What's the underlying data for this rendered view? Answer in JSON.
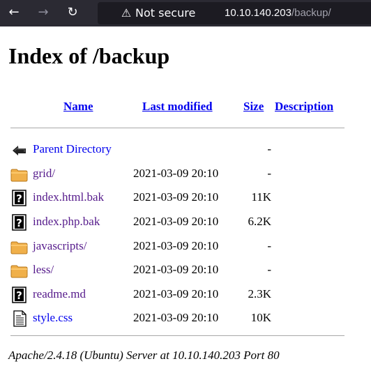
{
  "browser": {
    "back_icon": "arrow-left-icon",
    "forward_icon": "arrow-right-icon",
    "reload_icon": "reload-icon",
    "security_label": "Not secure",
    "url_host": "10.10.140.203",
    "url_path": "/backup/"
  },
  "page": {
    "title": "Index of /backup",
    "columns": {
      "name": "Name",
      "last_modified": "Last modified",
      "size": "Size",
      "description": "Description"
    },
    "rows": [
      {
        "name": "Parent Directory",
        "date": "",
        "size": "-",
        "icon": "parent-directory-icon",
        "visited": false
      },
      {
        "name": "grid/",
        "date": "2021-03-09 20:10",
        "size": "-",
        "icon": "folder-icon",
        "visited": true
      },
      {
        "name": "index.html.bak",
        "date": "2021-03-09 20:10",
        "size": "11K",
        "icon": "unknown-file-icon",
        "visited": true
      },
      {
        "name": "index.php.bak",
        "date": "2021-03-09 20:10",
        "size": "6.2K",
        "icon": "unknown-file-icon",
        "visited": true
      },
      {
        "name": "javascripts/",
        "date": "2021-03-09 20:10",
        "size": "-",
        "icon": "folder-icon",
        "visited": true
      },
      {
        "name": "less/",
        "date": "2021-03-09 20:10",
        "size": "-",
        "icon": "folder-icon",
        "visited": true
      },
      {
        "name": "readme.md",
        "date": "2021-03-09 20:10",
        "size": "2.3K",
        "icon": "unknown-file-icon",
        "visited": true
      },
      {
        "name": "style.css",
        "date": "2021-03-09 20:10",
        "size": "10K",
        "icon": "text-file-icon",
        "visited": false
      }
    ],
    "footer": "Apache/2.4.18 (Ubuntu) Server at 10.10.140.203 Port 80"
  },
  "colors": {
    "link": "#0000ee",
    "visited": "#551a8b",
    "chrome_bg": "#2b2a33"
  }
}
